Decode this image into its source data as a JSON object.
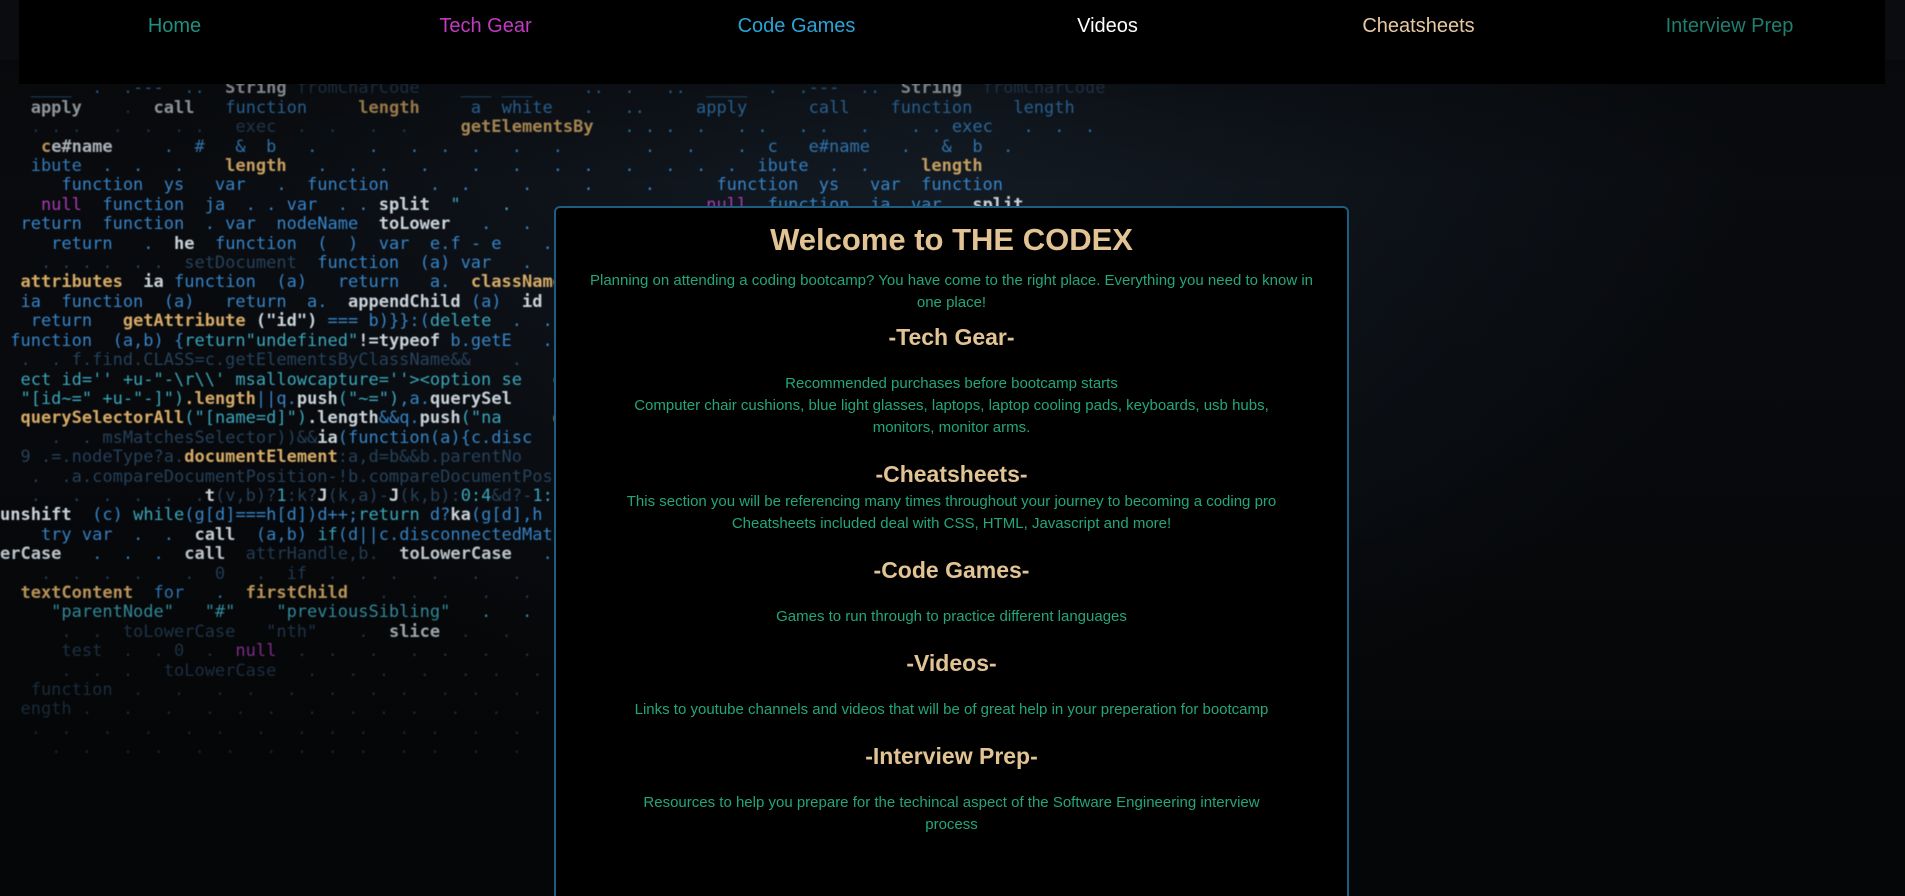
{
  "nav": {
    "items": [
      {
        "label": "Home",
        "color": "#1f8f7f"
      },
      {
        "label": "Tech Gear",
        "color": "#c23ac2"
      },
      {
        "label": "Code Games",
        "color": "#2aa3d6"
      },
      {
        "label": "Videos",
        "color": "#ffffff"
      },
      {
        "label": "Cheatsheets",
        "color": "#e6c9a0"
      },
      {
        "label": "Interview Prep",
        "color": "#1f7f6f"
      }
    ]
  },
  "main": {
    "title": "Welcome to THE CODEX",
    "intro": "Planning on attending a coding bootcamp? You have come to the right place. Everything you need to know in one place!",
    "sections": [
      {
        "title": "-Tech Gear-",
        "lines": [
          "Recommended purchases before bootcamp starts",
          "Computer chair cushions, blue light glasses, laptops, laptop cooling pads, keyboards, usb hubs, monitors, monitor arms."
        ]
      },
      {
        "title": "-Cheatsheets-",
        "lines": [
          "This section you will be referencing many times throughout your journey to becoming a coding pro",
          "Cheatsheets included deal with CSS, HTML, Javascript and more!"
        ]
      },
      {
        "title": "-Code Games-",
        "lines": [
          "Games to run through to practice different languages"
        ]
      },
      {
        "title": "-Videos-",
        "lines": [
          "Links to youtube channels and videos that will be of great help in your preperation for bootcamp"
        ]
      },
      {
        "title": "-Interview Prep-",
        "lines": [
          "Resources to help you prepare for the techincal aspect of the Software Engineering interview process"
        ]
      }
    ]
  },
  "colors": {
    "heading": "#e2c394",
    "body_text": "#24a67a",
    "card_border": "#1c5d80",
    "nav_background": "#000000"
  }
}
